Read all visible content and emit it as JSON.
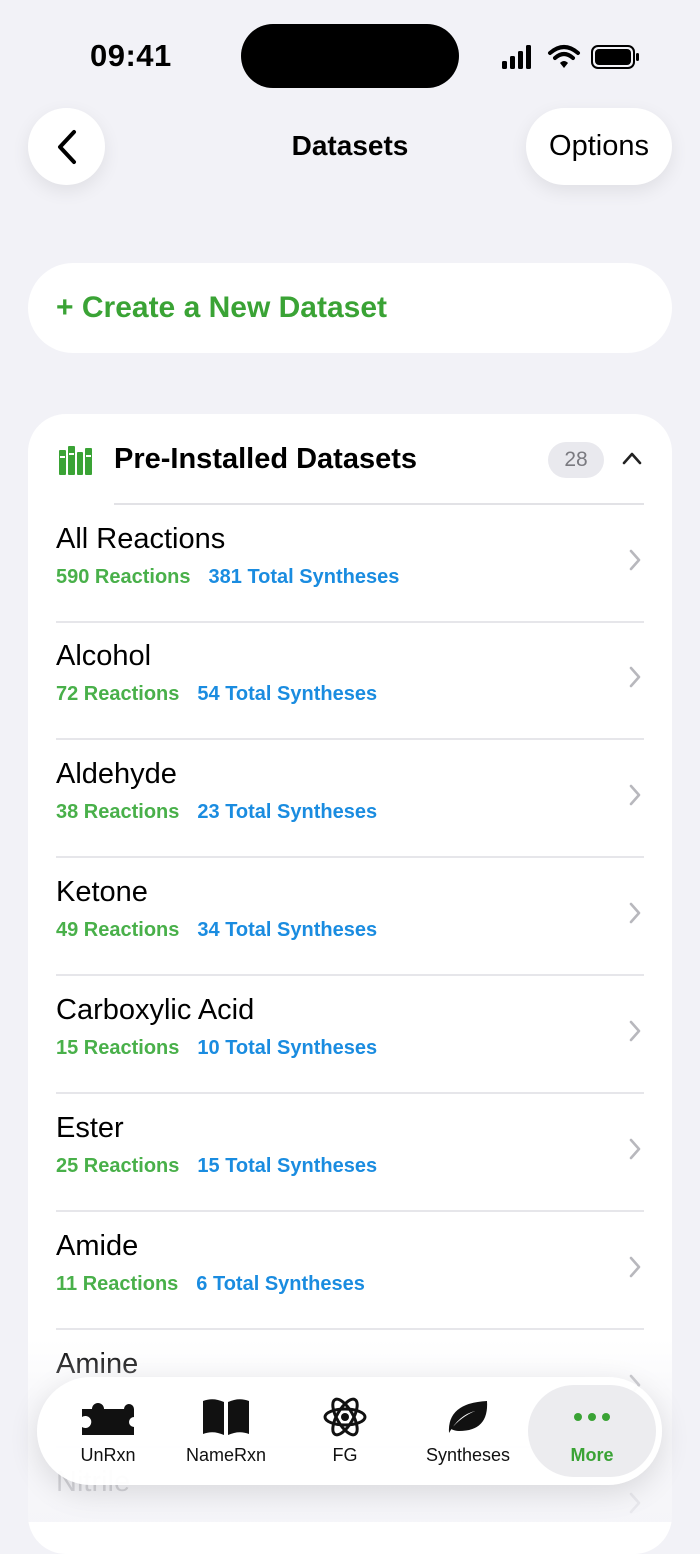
{
  "status_bar": {
    "time": "09:41"
  },
  "nav": {
    "title": "Datasets",
    "options_label": "Options"
  },
  "create_button": {
    "label": "+ Create a New Dataset"
  },
  "section": {
    "title": "Pre-Installed Datasets",
    "count": "28",
    "rows": [
      {
        "title": "All Reactions",
        "reactions": "590 Reactions",
        "syntheses": "381 Total Syntheses"
      },
      {
        "title": "Alcohol",
        "reactions": "72 Reactions",
        "syntheses": "54 Total Syntheses"
      },
      {
        "title": "Aldehyde",
        "reactions": "38 Reactions",
        "syntheses": "23 Total Syntheses"
      },
      {
        "title": "Ketone",
        "reactions": "49 Reactions",
        "syntheses": "34 Total Syntheses"
      },
      {
        "title": "Carboxylic Acid",
        "reactions": "15 Reactions",
        "syntheses": "10 Total Syntheses"
      },
      {
        "title": "Ester",
        "reactions": "25 Reactions",
        "syntheses": "15 Total Syntheses"
      },
      {
        "title": "Amide",
        "reactions": "11 Reactions",
        "syntheses": "6 Total Syntheses"
      },
      {
        "title": "Amine",
        "reactions": "",
        "syntheses": ""
      },
      {
        "title": "Nitrile",
        "reactions": "",
        "syntheses": ""
      }
    ]
  },
  "tab_bar": {
    "tabs": [
      {
        "label": "UnRxn",
        "icon": "puzzle-icon"
      },
      {
        "label": "NameRxn",
        "icon": "book-icon"
      },
      {
        "label": "FG",
        "icon": "atom-icon"
      },
      {
        "label": "Syntheses",
        "icon": "leaf-icon"
      },
      {
        "label": "More",
        "icon": "ellipsis-icon"
      }
    ],
    "active_color": "#3aa335"
  },
  "colors": {
    "accent_green": "#3aa335",
    "reactions_green": "#49b04a",
    "syntheses_blue": "#1a8ce0",
    "background": "#f2f2f7"
  }
}
